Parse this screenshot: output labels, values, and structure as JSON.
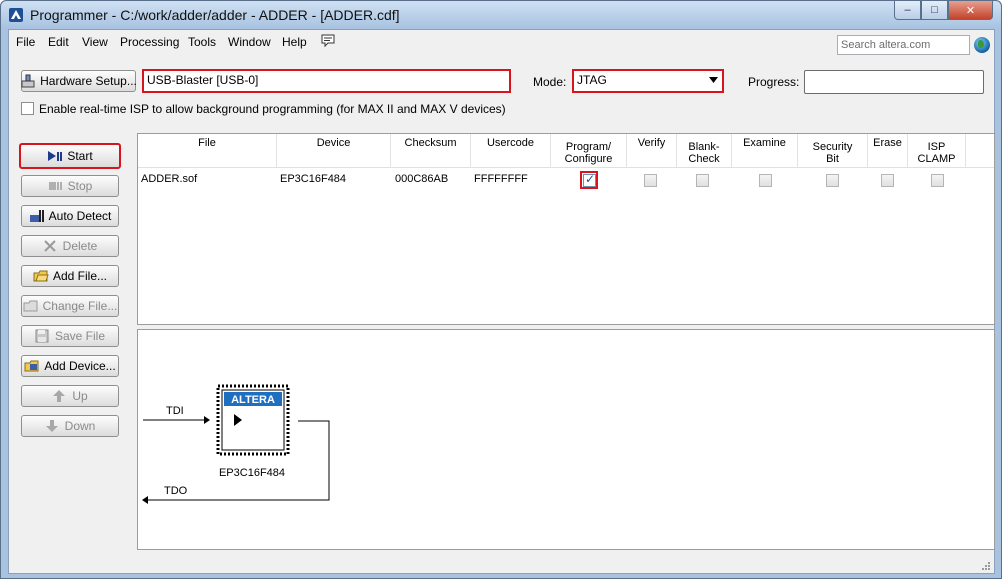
{
  "window": {
    "title": "Programmer - C:/work/adder/adder - ADDER - [ADDER.cdf]",
    "minimize_glyph": "–",
    "maximize_glyph": "□",
    "close_glyph": "✕"
  },
  "menu": {
    "items": [
      "File",
      "Edit",
      "View",
      "Processing",
      "Tools",
      "Window",
      "Help"
    ],
    "search_placeholder": "Search altera.com"
  },
  "hardware": {
    "setup_label": "Hardware Setup...",
    "device_value": "USB-Blaster [USB-0]",
    "mode_label": "Mode:",
    "mode_value": "JTAG",
    "progress_label": "Progress:",
    "progress_value": 0,
    "isp_label": "Enable real-time ISP to allow background programming (for MAX II and MAX V devices)",
    "isp_checked": false
  },
  "side_buttons": [
    {
      "label": "Start",
      "enabled": true,
      "icon": "start-icon"
    },
    {
      "label": "Stop",
      "enabled": false,
      "icon": "stop-icon"
    },
    {
      "label": "Auto Detect",
      "enabled": true,
      "icon": "auto-detect-icon"
    },
    {
      "label": "Delete",
      "enabled": false,
      "icon": "delete-icon"
    },
    {
      "label": "Add File...",
      "enabled": true,
      "icon": "add-file-icon"
    },
    {
      "label": "Change File...",
      "enabled": false,
      "icon": "change-file-icon"
    },
    {
      "label": "Save File",
      "enabled": false,
      "icon": "save-file-icon"
    },
    {
      "label": "Add Device...",
      "enabled": true,
      "icon": "add-device-icon"
    },
    {
      "label": "Up",
      "enabled": false,
      "icon": "up-arrow-icon"
    },
    {
      "label": "Down",
      "enabled": false,
      "icon": "down-arrow-icon"
    }
  ],
  "table": {
    "columns": {
      "file": "File",
      "device": "Device",
      "checksum": "Checksum",
      "usercode": "Usercode",
      "program_1": "Program/",
      "program_2": "Configure",
      "verify": "Verify",
      "blank_1": "Blank-",
      "blank_2": "Check",
      "examine": "Examine",
      "security_1": "Security",
      "security_2": "Bit",
      "erase": "Erase",
      "isp_1": "ISP",
      "isp_2": "CLAMP"
    },
    "rows": [
      {
        "file": "ADDER.sof",
        "device": "EP3C16F484",
        "checksum": "000C86AB",
        "usercode": "FFFFFFFF",
        "program_configure": true,
        "verify": false,
        "blank_check": false,
        "examine": false,
        "security_bit": false,
        "erase": false,
        "isp_clamp": false
      }
    ]
  },
  "diagram": {
    "tdi_label": "TDI",
    "tdo_label": "TDO",
    "chip_label": "EP3C16F484",
    "logo_text": "ALTERA"
  },
  "colors": {
    "highlight": "#d8141d",
    "window_frame": "#a9c3df",
    "altera_blue": "#1f6fc1"
  }
}
